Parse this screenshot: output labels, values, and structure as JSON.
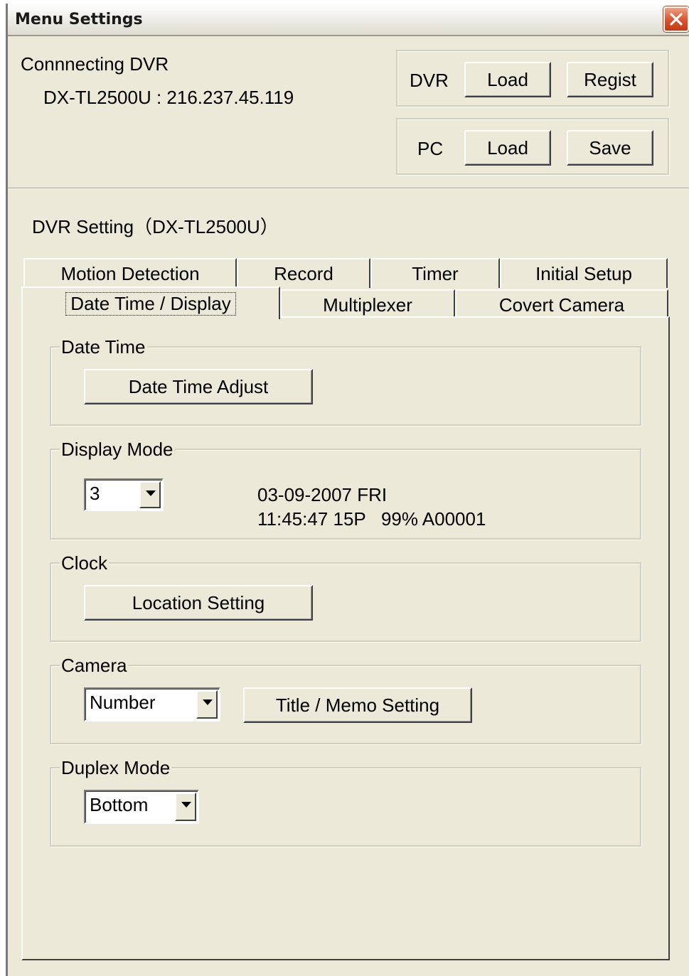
{
  "window": {
    "title": "Menu Settings"
  },
  "connection": {
    "label": "Connnecting DVR",
    "device": "DX-TL2500U : 216.237.45.119"
  },
  "dvr_row": {
    "label": "DVR",
    "load": "Load",
    "regist": "Regist"
  },
  "pc_row": {
    "label": "PC",
    "load": "Load",
    "save": "Save"
  },
  "setting_title": "DVR Setting（DX-TL2500U）",
  "tabs": {
    "back_row": [
      "Motion Detection",
      "Record",
      "Timer",
      "Initial Setup"
    ],
    "front_row": [
      "Date Time / Display",
      "Multiplexer",
      "Covert Camera"
    ],
    "active": "Date Time / Display"
  },
  "groups": {
    "date_time": {
      "title": "Date Time",
      "button": "Date Time Adjust"
    },
    "display_mode": {
      "title": "Display Mode",
      "value": "3",
      "preview_line1": "03-09-2007 FRI",
      "preview_line2": "11:45:47 15P   99% A00001"
    },
    "clock": {
      "title": "Clock",
      "button": "Location Setting"
    },
    "camera": {
      "title": "Camera",
      "select_value": "Number",
      "button": "Title / Memo Setting"
    },
    "duplex_mode": {
      "title": "Duplex Mode",
      "value": "Bottom"
    }
  },
  "icons": {
    "close": "close-icon",
    "dropdown": "chevron-down-icon"
  },
  "colors": {
    "window_bg": "#ece9d8",
    "close_button": "#d9512c"
  }
}
